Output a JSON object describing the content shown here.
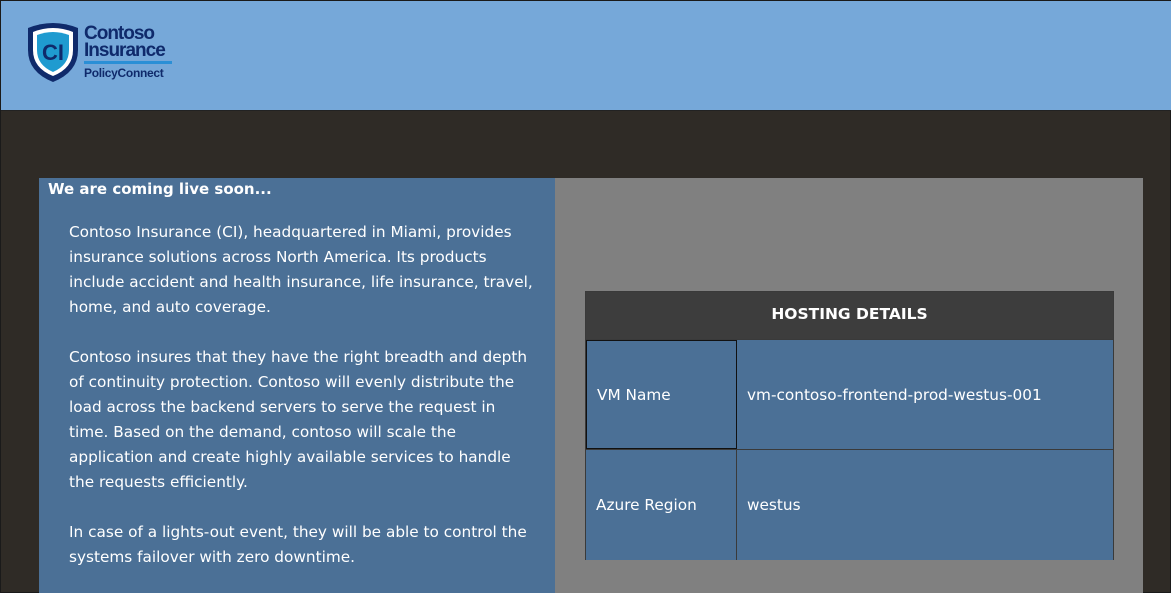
{
  "header": {
    "logo": {
      "initials": "CI",
      "line1": "Contoso",
      "line2": "Insurance",
      "line3": "PolicyConnect"
    }
  },
  "main": {
    "title": "We are coming live soon...",
    "paragraphs": [
      "Contoso Insurance (CI), headquartered in Miami, provides insurance solutions across North America. Its products include accident and health insurance, life insurance, travel, home, and auto coverage.",
      "Contoso insures that they have the right breadth and depth of continuity protection. Contoso will evenly distribute the load across the backend servers to serve the request in time. Based on the demand, contoso will scale the application and create highly available services to handle the requests efficiently.",
      "In case of a lights-out event, they will be able to control the systems failover with zero downtime."
    ]
  },
  "hosting": {
    "title": "HOSTING DETAILS",
    "rows": [
      {
        "label": "VM Name",
        "value": "vm-contoso-frontend-prod-westus-001"
      },
      {
        "label": "Azure Region",
        "value": "westus"
      }
    ]
  },
  "colors": {
    "header_bg": "#76a8d9",
    "page_bg": "#2f2b26",
    "panel_bg": "#4b7096",
    "content_bg": "#808080",
    "table_header_bg": "#3d3d3d",
    "logo_navy": "#0f2a6b"
  }
}
